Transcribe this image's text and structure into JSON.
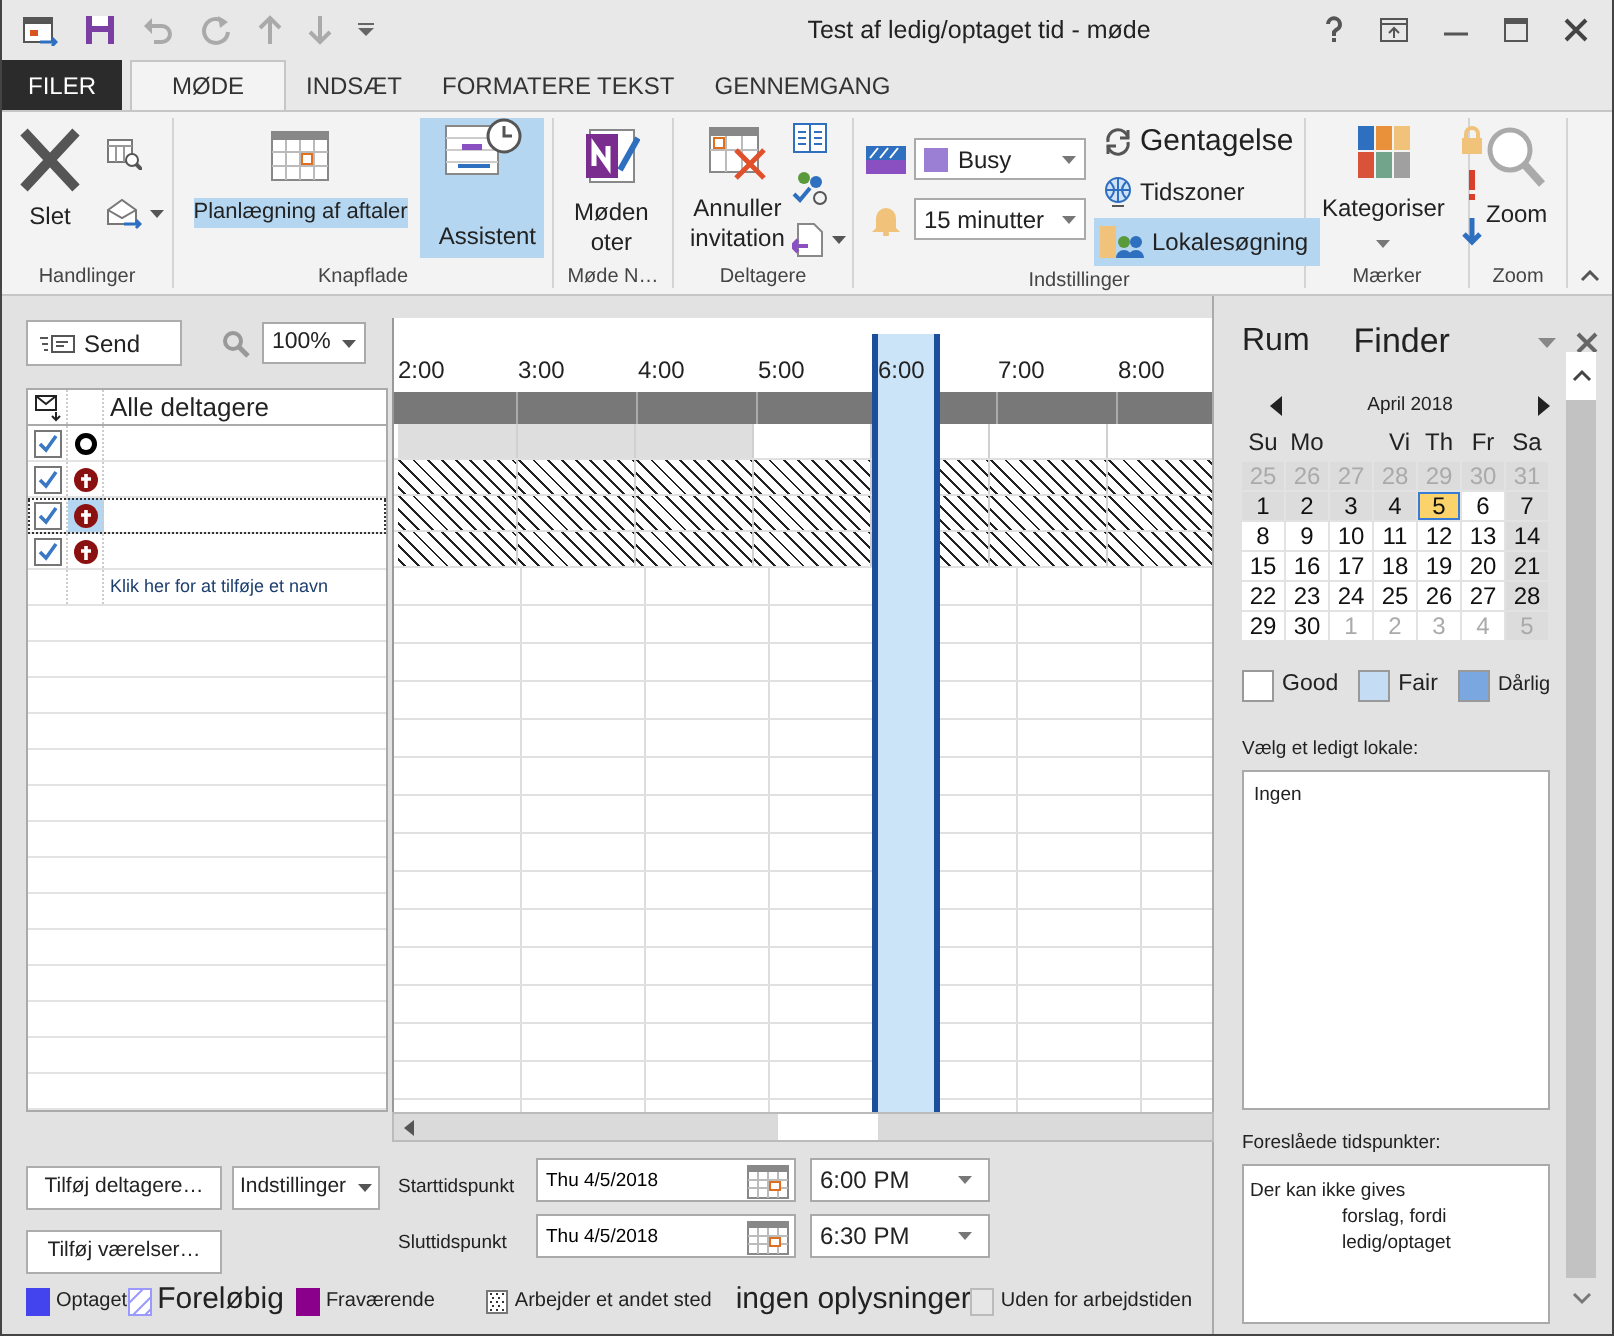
{
  "window": {
    "title": "Test af ledig/optaget tid - møde"
  },
  "tabs": [
    {
      "label": "FILER",
      "kind": "file",
      "selected": false
    },
    {
      "label": "MØDE",
      "kind": "tab",
      "selected": true
    },
    {
      "label": "INDSÆT",
      "kind": "tab",
      "selected": false
    },
    {
      "label": "FORMATERE TEKST",
      "kind": "tab",
      "selected": false
    },
    {
      "label": "GENNEMGANG",
      "kind": "tab",
      "selected": false
    }
  ],
  "ribbon": {
    "actions": {
      "label": "Handlinger",
      "delete": "Slet"
    },
    "views": {
      "label": "Knapflade",
      "buttons": [
        {
          "label": "Planlægning af aftaler",
          "selected": false
        },
        {
          "label": "Assistent",
          "selected": true
        }
      ]
    },
    "notes": {
      "label": "Møde N…",
      "lines": [
        "Møden",
        "oter"
      ]
    },
    "attendees": {
      "label": "Deltagere",
      "lines": [
        "Annuller",
        "invitation"
      ]
    },
    "options": {
      "label": "Indstillinger",
      "show_as": "Busy",
      "reminder": "15 minutter",
      "recurrence": "Gentagelse",
      "time_zones": "Tidszoner",
      "room_finder": {
        "label": "Lokalesøgning",
        "selected": true
      }
    },
    "tags": {
      "label": "Mærker",
      "categorize": "Kategoriser"
    },
    "zoom": {
      "label": "Zoom",
      "button": "Zoom"
    }
  },
  "toolbar": {
    "send": "Send",
    "zoom": "100%"
  },
  "attendee_list": {
    "header": "Alle deltagere",
    "rows": [
      {
        "kind": "organizer",
        "checked": true,
        "selected": false,
        "no_info": false
      },
      {
        "kind": "required",
        "checked": true,
        "selected": false,
        "no_info": true
      },
      {
        "kind": "required",
        "checked": true,
        "selected": true,
        "no_info": true
      },
      {
        "kind": "required",
        "checked": true,
        "selected": false,
        "no_info": true
      }
    ],
    "add_hint": "Klik her for at tilføje et navn"
  },
  "timeline": {
    "times": [
      {
        "label": "2:00",
        "outside_hours": true,
        "meeting": false
      },
      {
        "label": "3:00",
        "outside_hours": true,
        "meeting": false
      },
      {
        "label": "4:00",
        "outside_hours": true,
        "meeting": false
      },
      {
        "label": "5:00",
        "outside_hours": false,
        "meeting": false
      },
      {
        "label": "6:00",
        "outside_hours": false,
        "meeting": true
      },
      {
        "label": "7:00",
        "outside_hours": false,
        "meeting": false
      },
      {
        "label": "8:00",
        "outside_hours": false,
        "meeting": false
      }
    ]
  },
  "controls": {
    "add_attendees": "Tilføj deltagere…",
    "options": "Indstillinger",
    "add_rooms": "Tilføj værelser…",
    "start": {
      "label": "Starttidspunkt",
      "date": "Thu 4/5/2018",
      "time": "6:00 PM"
    },
    "end": {
      "label": "Sluttidspunkt",
      "date": "Thu 4/5/2018",
      "time": "6:30 PM"
    }
  },
  "legend": [
    {
      "label": "Optaget",
      "kind": "busy"
    },
    {
      "label": "Foreløbig",
      "kind": "tentative"
    },
    {
      "label": "Fraværende",
      "kind": "away"
    },
    {
      "label": "Arbejder et andet sted",
      "kind": "elsewhere"
    },
    {
      "label": "ingen oplysninger",
      "kind": "no_info"
    },
    {
      "label": "Uden for arbejdstiden",
      "kind": "outside_hours"
    }
  ],
  "room_finder": {
    "title": "Rum",
    "title_2": "Finder",
    "calendar": {
      "month": "April 2018",
      "weekdays": [
        {
          "label": "Su",
          "wide": false
        },
        {
          "label": "Mo",
          "wide": false
        },
        {
          "label": "Vi",
          "wide": true
        },
        {
          "label": "Th",
          "wide": false
        },
        {
          "label": "Fr",
          "wide": false
        },
        {
          "label": "Sa",
          "wide": false
        }
      ],
      "weeks": [
        [
          {
            "label": "25",
            "kind": "outside_blocked",
            "selected": false
          },
          {
            "label": "26",
            "kind": "outside_blocked",
            "selected": false
          },
          {
            "label": "27",
            "kind": "outside_blocked",
            "selected": false
          },
          {
            "label": "28",
            "kind": "outside_blocked",
            "selected": false
          },
          {
            "label": "29",
            "kind": "outside_blocked",
            "selected": false
          },
          {
            "label": "30",
            "kind": "outside_blocked",
            "selected": false
          },
          {
            "label": "31",
            "kind": "outside_blocked",
            "selected": false
          }
        ],
        [
          {
            "label": "1",
            "kind": "blocked",
            "selected": false
          },
          {
            "label": "2",
            "kind": "blocked",
            "selected": false
          },
          {
            "label": "3",
            "kind": "blocked",
            "selected": false
          },
          {
            "label": "4",
            "kind": "blocked",
            "selected": false
          },
          {
            "label": "5",
            "kind": "open",
            "selected": true
          },
          {
            "label": "6",
            "kind": "open",
            "selected": false
          },
          {
            "label": "7",
            "kind": "blocked",
            "selected": false
          }
        ],
        [
          {
            "label": "8",
            "kind": "open",
            "selected": false
          },
          {
            "label": "9",
            "kind": "open",
            "selected": false
          },
          {
            "label": "10",
            "kind": "open",
            "selected": false
          },
          {
            "label": "11",
            "kind": "open",
            "selected": false
          },
          {
            "label": "12",
            "kind": "open",
            "selected": false
          },
          {
            "label": "13",
            "kind": "open",
            "selected": false
          },
          {
            "label": "14",
            "kind": "blocked",
            "selected": false
          }
        ],
        [
          {
            "label": "15",
            "kind": "open",
            "selected": false
          },
          {
            "label": "16",
            "kind": "open",
            "selected": false
          },
          {
            "label": "17",
            "kind": "open",
            "selected": false
          },
          {
            "label": "18",
            "kind": "open",
            "selected": false
          },
          {
            "label": "19",
            "kind": "open",
            "selected": false
          },
          {
            "label": "20",
            "kind": "open",
            "selected": false
          },
          {
            "label": "21",
            "kind": "blocked",
            "selected": false
          }
        ],
        [
          {
            "label": "22",
            "kind": "open",
            "selected": false
          },
          {
            "label": "23",
            "kind": "open",
            "selected": false
          },
          {
            "label": "24",
            "kind": "open",
            "selected": false
          },
          {
            "label": "25",
            "kind": "open",
            "selected": false
          },
          {
            "label": "26",
            "kind": "open",
            "selected": false
          },
          {
            "label": "27",
            "kind": "open",
            "selected": false
          },
          {
            "label": "28",
            "kind": "blocked",
            "selected": false
          }
        ],
        [
          {
            "label": "29",
            "kind": "open",
            "selected": false
          },
          {
            "label": "30",
            "kind": "open",
            "selected": false
          },
          {
            "label": "1",
            "kind": "outside",
            "selected": false
          },
          {
            "label": "2",
            "kind": "outside",
            "selected": false
          },
          {
            "label": "3",
            "kind": "outside",
            "selected": false
          },
          {
            "label": "4",
            "kind": "outside",
            "selected": false
          },
          {
            "label": "5",
            "kind": "outside_blocked",
            "selected": false
          }
        ]
      ]
    },
    "quality": [
      {
        "label": "Good",
        "color": "#ffffff"
      },
      {
        "label": "Fair",
        "color": "#c5dcf5"
      },
      {
        "label": "Dårlig",
        "color": "#7aa7e0"
      }
    ],
    "room_label": "Vælg et ledigt lokale:",
    "rooms": [
      "Ingen"
    ],
    "suggestions_label": "Foreslåede tidspunkter:",
    "suggestions": [
      "Der kan ikke gives",
      "forslag, fordi",
      "ledig/optaget"
    ]
  }
}
